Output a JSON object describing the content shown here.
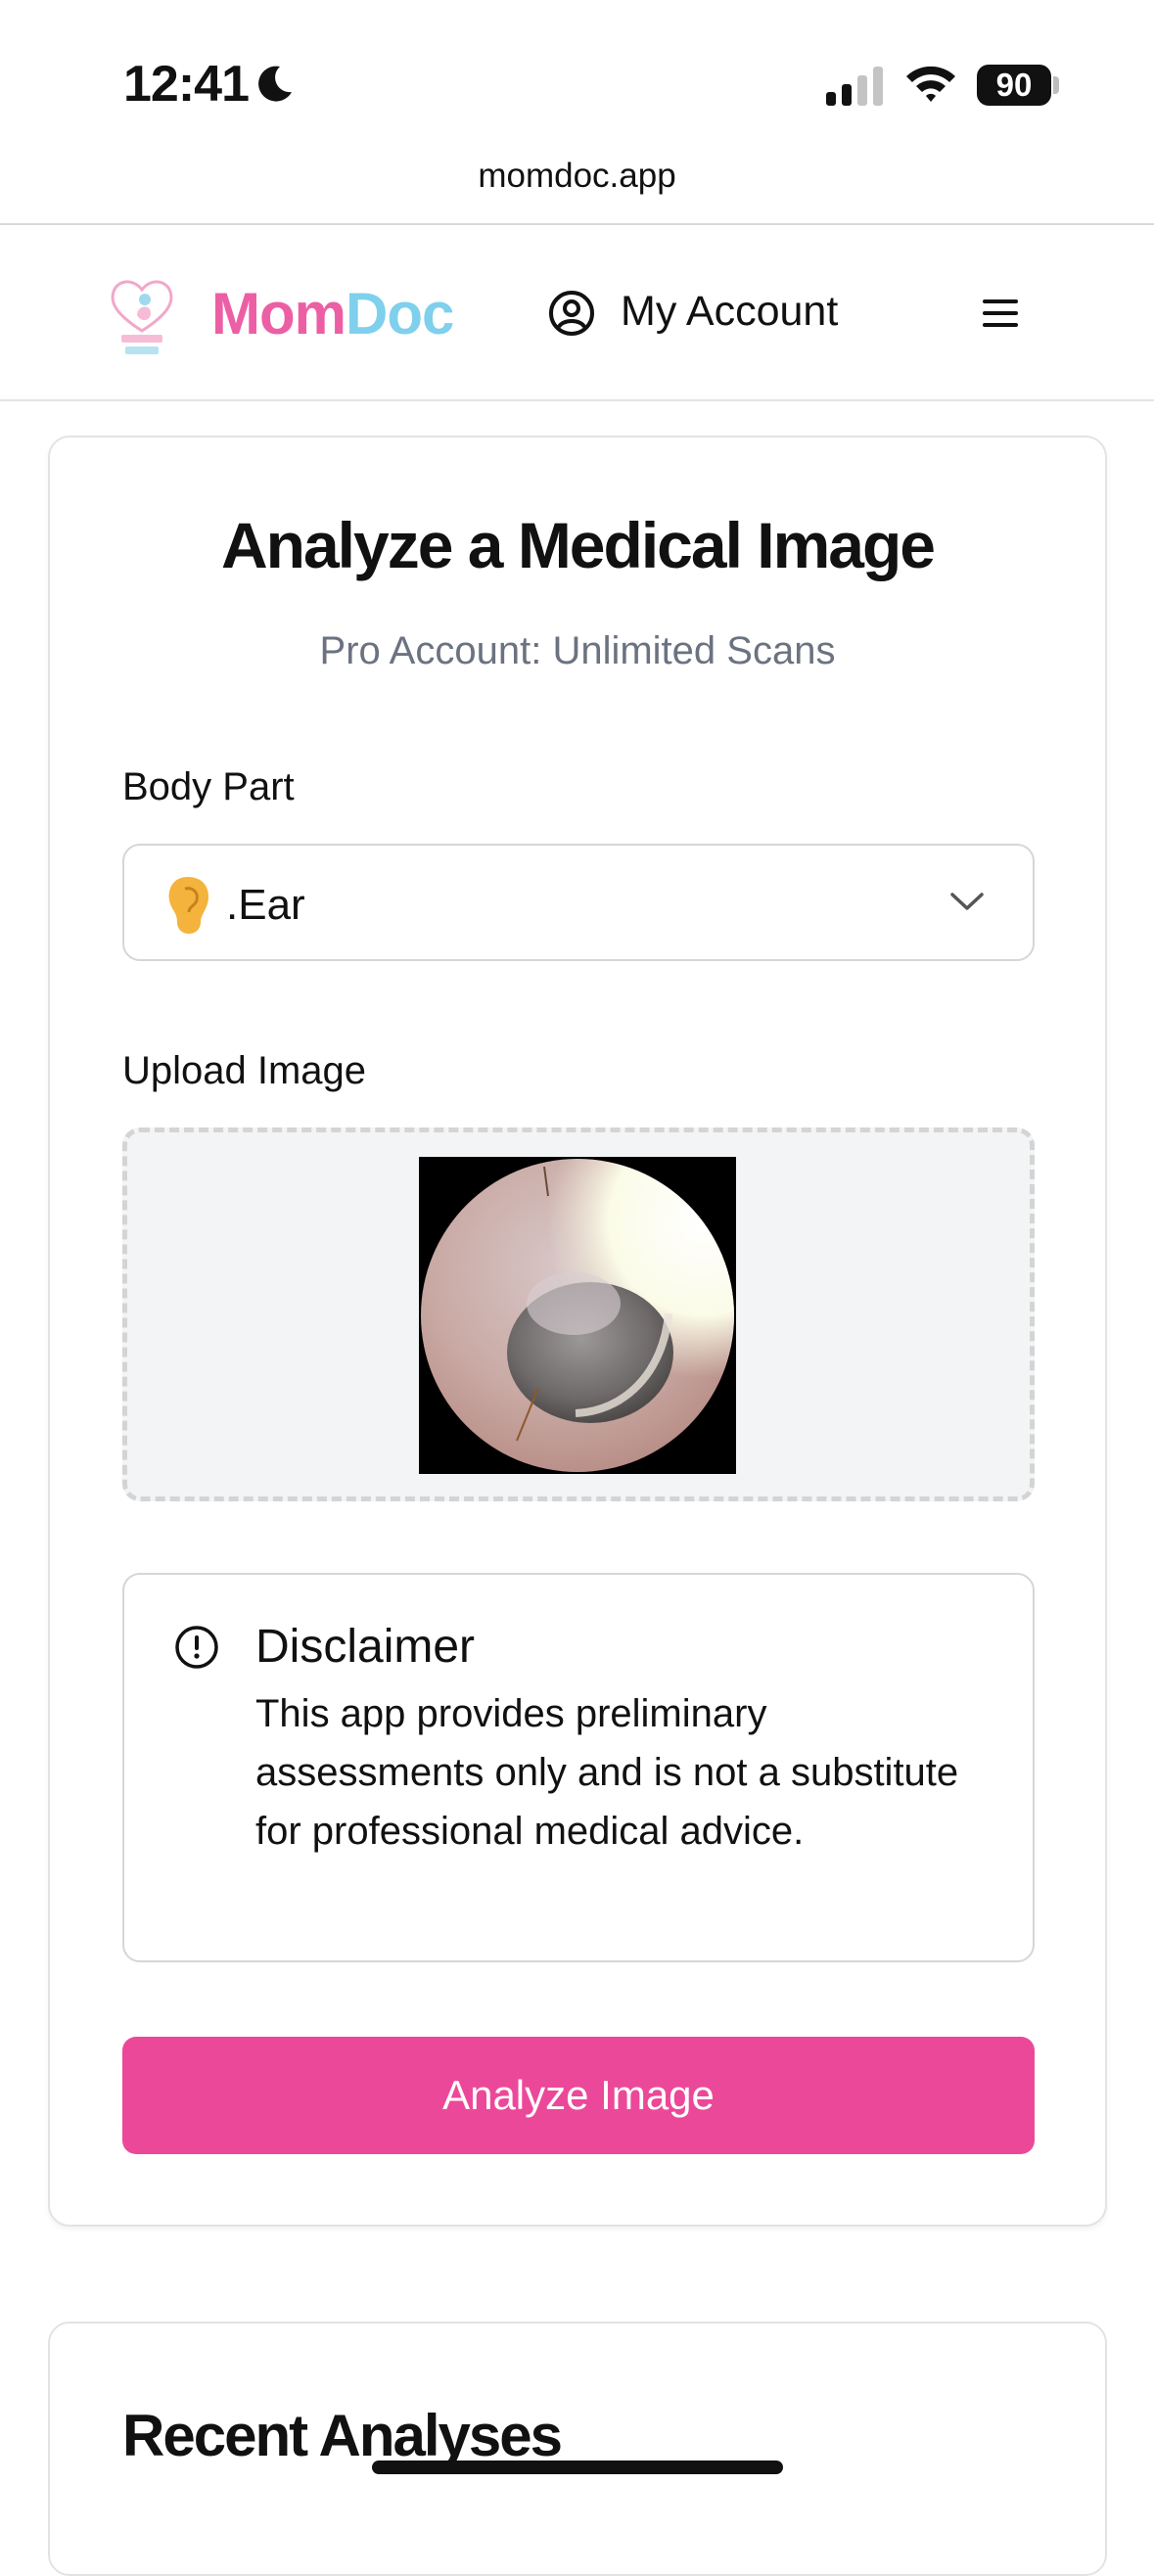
{
  "status_bar": {
    "time": "12:41",
    "battery": "90"
  },
  "browser": {
    "url": "momdoc.app"
  },
  "navbar": {
    "brand_mom": "Mom",
    "brand_doc": "Doc",
    "account_label": "My Account"
  },
  "analyze": {
    "title": "Analyze a Medical Image",
    "subtitle": "Pro Account: Unlimited Scans",
    "body_part_label": "Body Part",
    "body_part_value": ".Ear",
    "upload_label": "Upload Image",
    "disclaimer_title": "Disclaimer",
    "disclaimer_text": "This app provides preliminary assessments only and is not a substitute for professional medical advice.",
    "button_label": "Analyze Image"
  },
  "recent": {
    "title": "Recent Analyses"
  },
  "colors": {
    "accent_pink": "#ec4899",
    "brand_pink": "#ec5fa4",
    "brand_blue": "#7fd0ec",
    "muted_text": "#6b7280"
  }
}
